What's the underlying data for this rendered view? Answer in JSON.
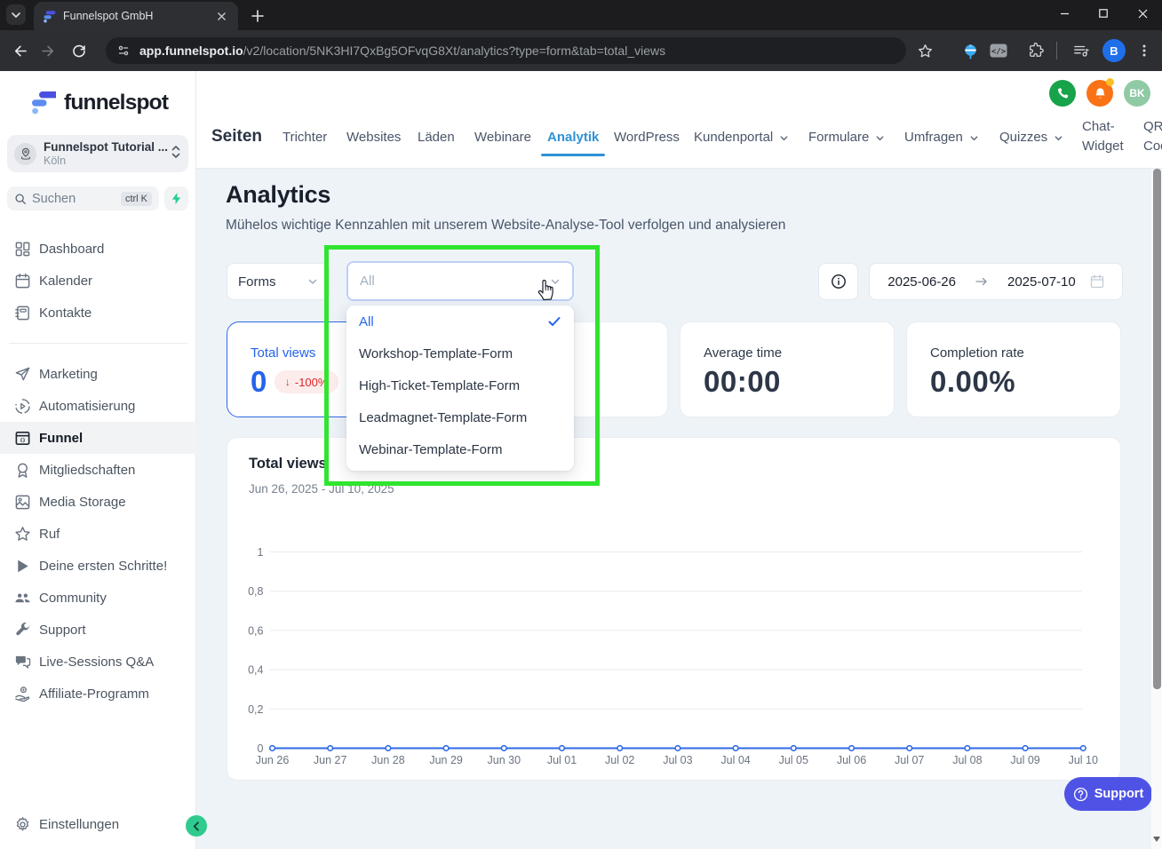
{
  "colors": {
    "brand_blue": "#2563eb",
    "nav_active_blue": "#2e93d6",
    "annotation_green": "#2fe52f",
    "support_indigo": "#4f53e5",
    "badge_red": "#dc2626",
    "chart_line": "#2f6ae4",
    "sidebar_green": "#2fcb8e",
    "phone_green": "#16a34a",
    "bell_orange": "#f97316",
    "avatar_green": "#8fcaa4"
  },
  "browser": {
    "tab_title": "Funnelspot GmbH",
    "url_domain": "app.funnelspot.io",
    "url_path": "/v2/location/5NK3HI7QxBg5OFvqG8Xt/analytics?type=form&tab=total_views",
    "profile_initial": "B",
    "code_badge": "</>"
  },
  "sidebar": {
    "logo_text": "funnelspot",
    "workspace": {
      "name": "Funnelspot Tutorial ...",
      "location": "Köln"
    },
    "search": {
      "placeholder": "Suchen",
      "shortcut": "ctrl K"
    },
    "items": [
      {
        "label": "Dashboard",
        "icon": "dashboard",
        "active": false
      },
      {
        "label": "Kalender",
        "icon": "calendar",
        "active": false
      },
      {
        "label": "Kontakte",
        "icon": "contacts",
        "active": false
      },
      {
        "label": "-",
        "icon": "",
        "active": false
      },
      {
        "label": "Marketing",
        "icon": "marketing",
        "active": false
      },
      {
        "label": "Automatisierung",
        "icon": "automation",
        "active": false
      },
      {
        "label": "Funnel",
        "icon": "funnel",
        "active": true
      },
      {
        "label": "Mitgliedschaften",
        "icon": "membership",
        "active": false
      },
      {
        "label": "Media Storage",
        "icon": "media",
        "active": false
      },
      {
        "label": "Ruf",
        "icon": "star",
        "active": false
      },
      {
        "label": "Deine ersten Schritte!",
        "icon": "play",
        "active": false
      },
      {
        "label": "Community",
        "icon": "community",
        "active": false
      },
      {
        "label": "Support",
        "icon": "wrench",
        "active": false
      },
      {
        "label": "Live-Sessions Q&A",
        "icon": "chat",
        "active": false
      },
      {
        "label": "Affiliate-Programm",
        "icon": "affiliate",
        "active": false
      }
    ],
    "settings_label": "Einstellungen"
  },
  "topnav": {
    "title": "Seiten",
    "tabs": [
      {
        "label": "Trichter",
        "active": false,
        "chevron": false
      },
      {
        "label": "Websites",
        "active": false,
        "chevron": false
      },
      {
        "label": "Läden",
        "active": false,
        "chevron": false
      },
      {
        "label": "Webinare",
        "active": false,
        "chevron": false
      },
      {
        "label": "Analytik",
        "active": true,
        "chevron": false
      },
      {
        "label": "WordPress",
        "active": false,
        "chevron": false
      },
      {
        "label": "Kundenportal",
        "active": false,
        "chevron": true
      },
      {
        "label": "Formulare",
        "active": false,
        "chevron": true
      },
      {
        "label": "Umfragen",
        "active": false,
        "chevron": true
      },
      {
        "label": "Quizzes",
        "active": false,
        "chevron": true
      },
      {
        "label": "Chat-\nWidget",
        "active": false,
        "chevron": false,
        "twoline": true
      },
      {
        "label": "QR-\nCode",
        "active": false,
        "chevron": false,
        "twoline": true
      }
    ],
    "avatar_initials": "BK"
  },
  "page": {
    "title": "Analytics",
    "subtitle": "Mühelos wichtige Kennzahlen mit unserem Website-Analyse-Tool verfolgen und analysieren",
    "filters": {
      "type_select": "Forms",
      "form_select": "All",
      "date_from": "2025-06-26",
      "date_to": "2025-07-10"
    },
    "dropdown": {
      "options": [
        "All",
        "Workshop-Template-Form",
        "High-Ticket-Template-Form",
        "Leadmagnet-Template-Form",
        "Webinar-Template-Form"
      ],
      "selected": "All"
    }
  },
  "stats": [
    {
      "label": "Total views",
      "value": "0",
      "badge": "-100%",
      "accent": true
    },
    {
      "label": "",
      "value": "",
      "accent": false
    },
    {
      "label": "Average time",
      "value": "00:00",
      "accent": false
    },
    {
      "label": "Completion rate",
      "value": "0.00%",
      "accent": false
    }
  ],
  "chart_card": {
    "title": "Total views",
    "subtitle": "Jun 26, 2025 - Jul 10, 2025"
  },
  "chart_data": {
    "type": "line",
    "title": "Total views",
    "x": [
      "Jun 26",
      "Jun 27",
      "Jun 28",
      "Jun 29",
      "Jun 30",
      "Jul 01",
      "Jul 02",
      "Jul 03",
      "Jul 04",
      "Jul 05",
      "Jul 06",
      "Jul 07",
      "Jul 08",
      "Jul 09",
      "Jul 10"
    ],
    "values": [
      0,
      0,
      0,
      0,
      0,
      0,
      0,
      0,
      0,
      0,
      0,
      0,
      0,
      0,
      0
    ],
    "ylim": [
      0,
      1
    ],
    "yticks": [
      0,
      0.2,
      0.4,
      0.6,
      0.8,
      1
    ],
    "ytick_labels": [
      "0",
      "0,2",
      "0,4",
      "0,6",
      "0,8",
      "1"
    ],
    "grid": true,
    "legend": false
  },
  "support_label": "Support"
}
